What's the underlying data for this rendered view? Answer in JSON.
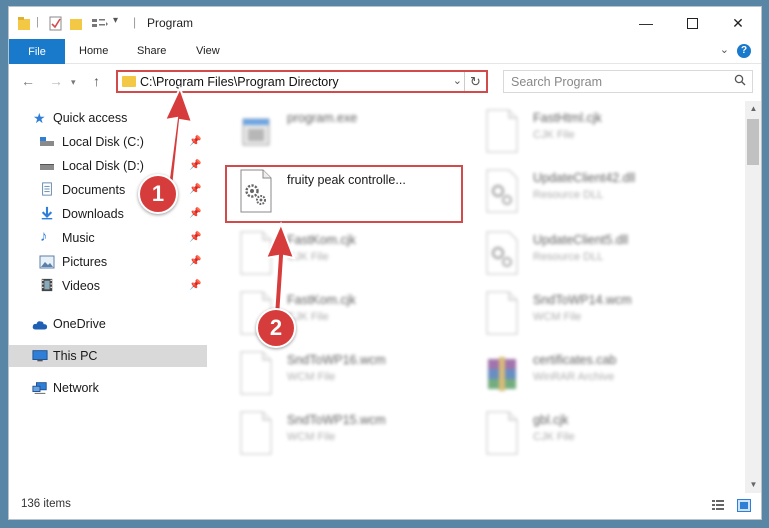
{
  "window": {
    "title": "Program"
  },
  "ribbon": {
    "file": "File",
    "home": "Home",
    "share": "Share",
    "view": "View",
    "help": "?"
  },
  "address": {
    "path": "C:\\Program Files\\Program Directory"
  },
  "search": {
    "placeholder": "Search Program"
  },
  "sidebar": {
    "quick_access": "Quick access",
    "items": [
      {
        "label": "Local Disk (C:)",
        "icon": "drive-icon"
      },
      {
        "label": "Local Disk (D:)",
        "icon": "drive-icon"
      },
      {
        "label": "Documents",
        "icon": "documents-icon"
      },
      {
        "label": "Downloads",
        "icon": "downloads-icon"
      },
      {
        "label": "Music",
        "icon": "music-icon"
      },
      {
        "label": "Pictures",
        "icon": "pictures-icon"
      },
      {
        "label": "Videos",
        "icon": "videos-icon"
      }
    ],
    "onedrive": "OneDrive",
    "this_pc": "This PC",
    "network": "Network"
  },
  "files": {
    "left": [
      {
        "name": "program.exe",
        "type": ""
      },
      {
        "name": "fruity peak controlle...",
        "type": ""
      },
      {
        "name": "FastKom.cjk",
        "type": "CJK File"
      },
      {
        "name": "FastKom.cjk",
        "type": "CJK File"
      },
      {
        "name": "SndToWP16.wcm",
        "type": "WCM File"
      },
      {
        "name": "SndToWP15.wcm",
        "type": "WCM File"
      }
    ],
    "right": [
      {
        "name": "FastHtml.cjk",
        "type": "CJK File"
      },
      {
        "name": "UpdateClient42.dll",
        "type": "Resource DLL"
      },
      {
        "name": "UpdateClient5.dll",
        "type": "Resource DLL"
      },
      {
        "name": "SndToWP14.wcm",
        "type": "WCM File"
      },
      {
        "name": "certificates.cab",
        "type": "WinRAR Archive"
      },
      {
        "name": "gbl.cjk",
        "type": "CJK File"
      }
    ]
  },
  "status": {
    "count": "136 items"
  },
  "annotations": {
    "step1": "1",
    "step2": "2"
  },
  "colors": {
    "accent": "#1979ca",
    "highlight": "#d24b4b",
    "badge": "#d73c3c"
  }
}
